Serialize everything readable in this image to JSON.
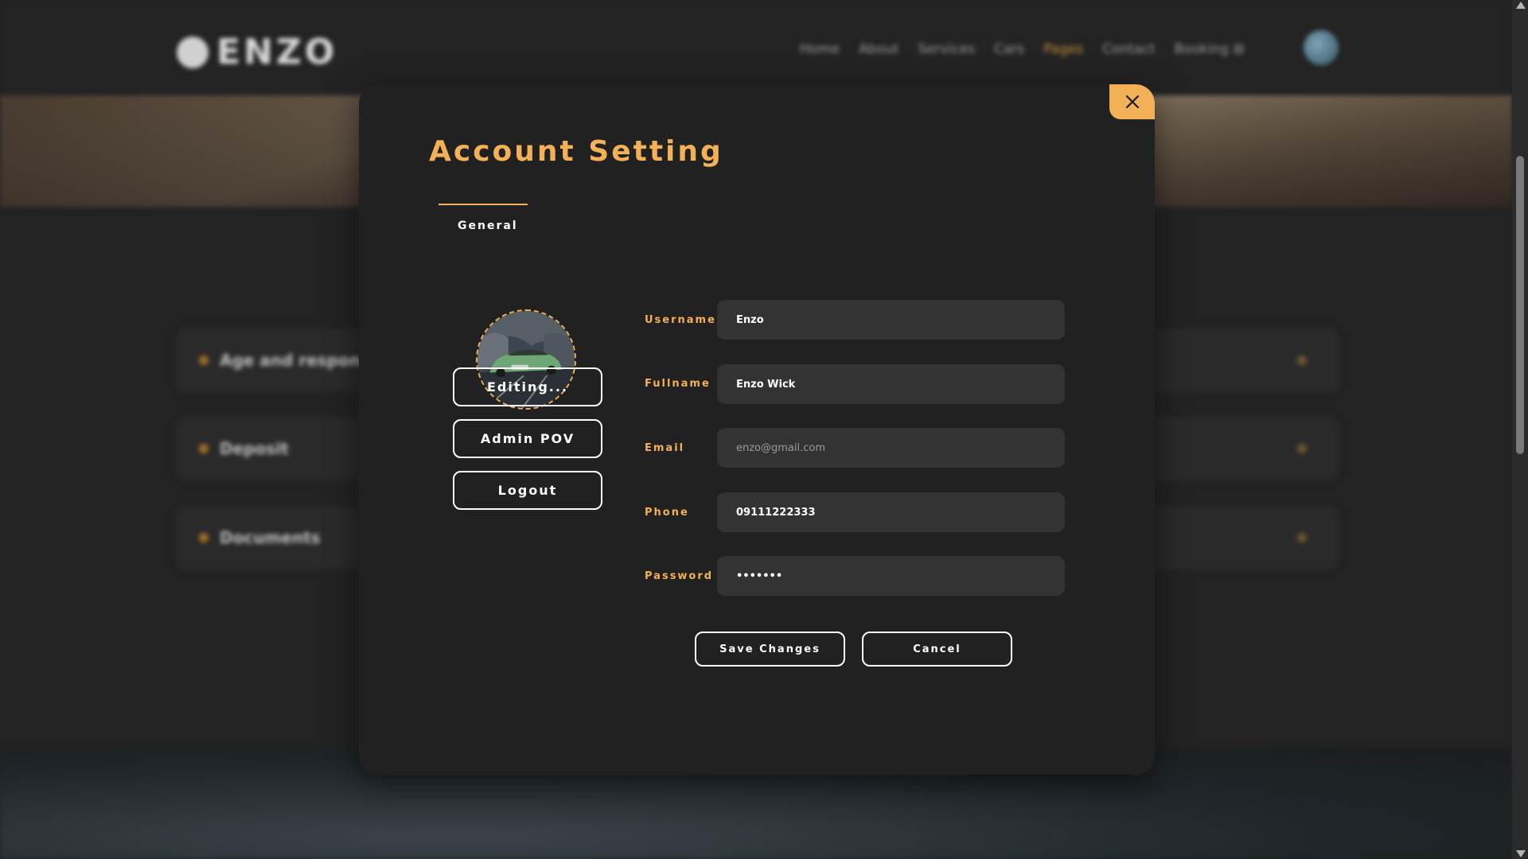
{
  "background": {
    "logo_text": "ENZO",
    "nav_items": [
      "Home",
      "About",
      "Services",
      "Cars",
      "Pages",
      "Contact",
      "Booking ⊞"
    ],
    "rows": [
      "Age and responsibility",
      "Deposit",
      "Documents"
    ]
  },
  "modal": {
    "title": "Account Setting",
    "tabs": [
      {
        "label": "General",
        "active": true
      }
    ],
    "side_buttons": {
      "editing": "Editing...",
      "admin": "Admin POV",
      "logout": "Logout"
    },
    "fields": {
      "username": {
        "label": "Username",
        "value": "Enzo"
      },
      "fullname": {
        "label": "Fullname",
        "value": "Enzo Wick"
      },
      "email": {
        "label": "Email",
        "placeholder": "enzo@gmail.com"
      },
      "phone": {
        "label": "Phone",
        "value": "09111222333"
      },
      "password": {
        "label": "Password",
        "value": "•••••••"
      }
    },
    "actions": {
      "save": "Save Changes",
      "cancel": "Cancel"
    },
    "close_icon": "close-icon"
  },
  "colors": {
    "accent": "#f3b157",
    "modal_bg": "#212121",
    "input_bg": "#333333"
  }
}
